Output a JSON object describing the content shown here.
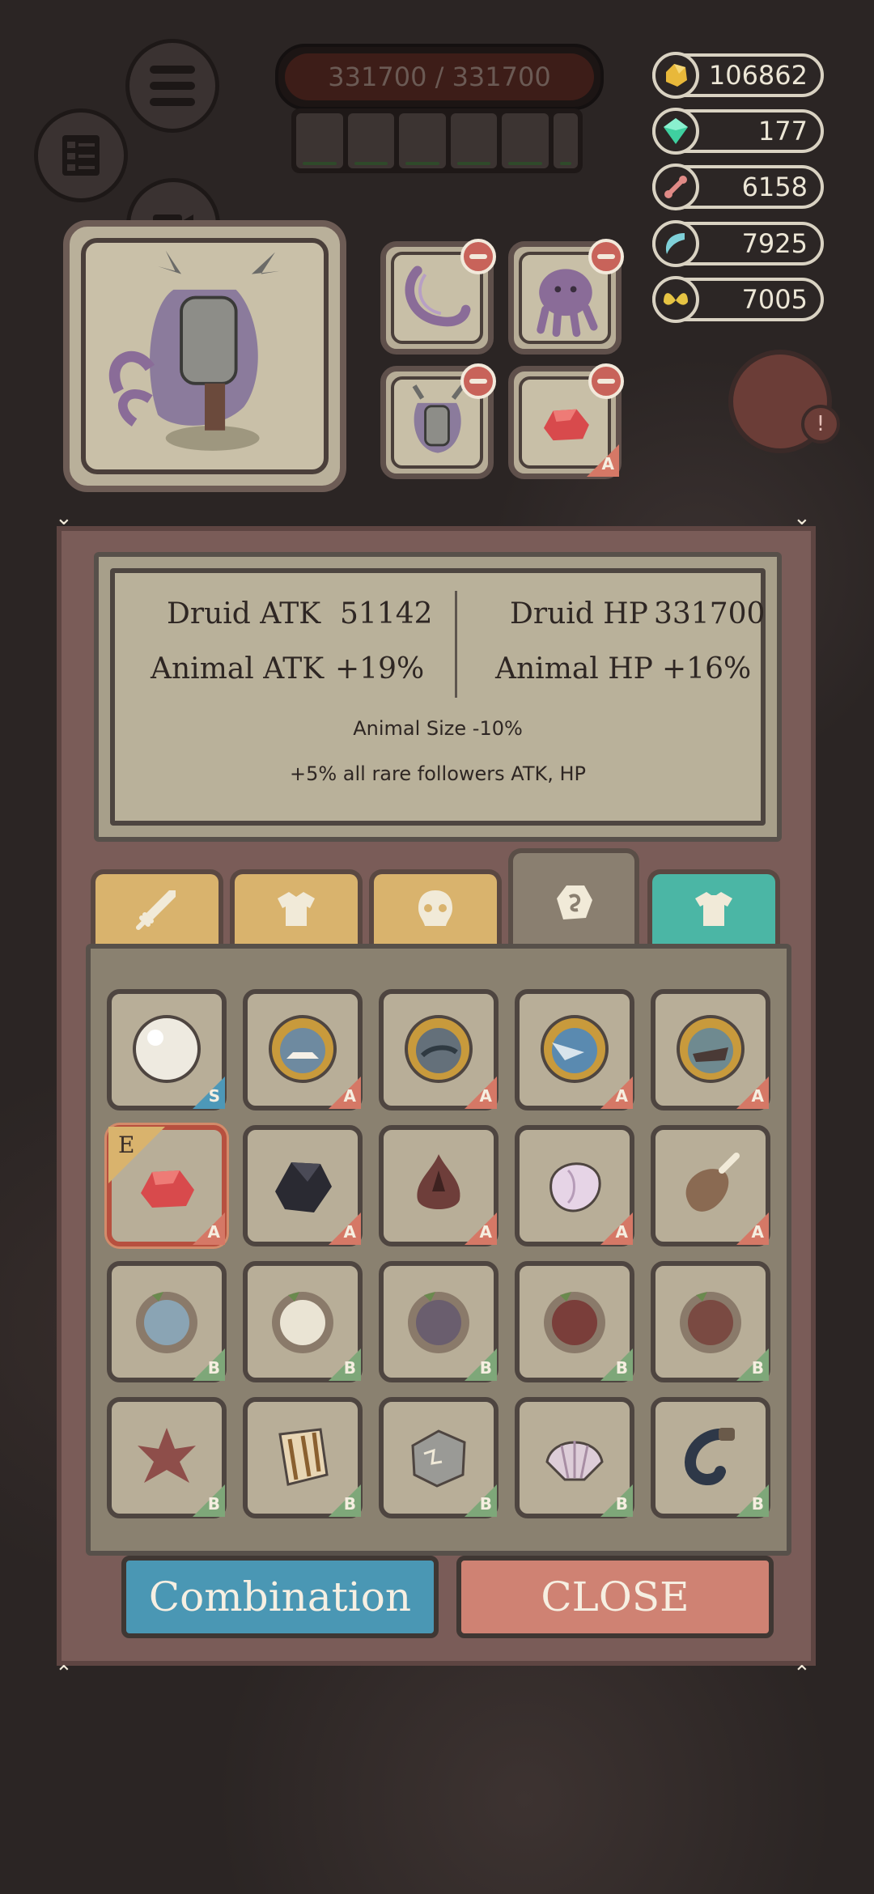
{
  "hud": {
    "hp_text": "331700 / 331700",
    "resources": [
      {
        "name": "gold",
        "value": "106862",
        "color": "#e8b83a",
        "icon": "gold-nugget-icon"
      },
      {
        "name": "gem",
        "value": "177",
        "color": "#3fd0a0",
        "icon": "gem-icon"
      },
      {
        "name": "bone",
        "value": "6158",
        "color": "#e08a86",
        "icon": "bone-icon"
      },
      {
        "name": "fang",
        "value": "7925",
        "color": "#7fd0d8",
        "icon": "fang-icon"
      },
      {
        "name": "wing",
        "value": "7005",
        "color": "#e6c443",
        "icon": "wing-icon"
      }
    ]
  },
  "stats": {
    "druid_atk_label": "Druid ATK",
    "druid_atk_value": "51142",
    "druid_hp_label": "Druid HP",
    "druid_hp_value": "331700",
    "animal_atk_label": "Animal ATK",
    "animal_atk_value": "+19%",
    "animal_hp_label": "Animal HP",
    "animal_hp_value": "+16%",
    "line1": "Animal Size -10%",
    "line2": "+5% all rare followers ATK, HP"
  },
  "equipped": {
    "slot_grade": "A"
  },
  "tabs": [
    {
      "icon": "sword-icon",
      "active": false
    },
    {
      "icon": "armor-icon",
      "active": false
    },
    {
      "icon": "skull-icon",
      "active": false
    },
    {
      "icon": "stone-icon",
      "active": true
    },
    {
      "icon": "shirt-icon",
      "active": false
    }
  ],
  "items": [
    {
      "name": "pearl",
      "grade": "S"
    },
    {
      "name": "shark-amulet",
      "grade": "A"
    },
    {
      "name": "fish-amulet",
      "grade": "A"
    },
    {
      "name": "marlin-amulet",
      "grade": "A"
    },
    {
      "name": "dino-amulet",
      "grade": "A"
    },
    {
      "name": "red-gem",
      "grade": "A",
      "equipped": "E"
    },
    {
      "name": "black-stone",
      "grade": "A"
    },
    {
      "name": "fire-crystal",
      "grade": "A"
    },
    {
      "name": "pink-shell",
      "grade": "A"
    },
    {
      "name": "meat-chunk",
      "grade": "A"
    },
    {
      "name": "blue-wreath",
      "grade": "B"
    },
    {
      "name": "white-wreath",
      "grade": "B"
    },
    {
      "name": "purple-wreath",
      "grade": "B"
    },
    {
      "name": "red-wreath",
      "grade": "B"
    },
    {
      "name": "brown-wreath",
      "grade": "B"
    },
    {
      "name": "red-leaf",
      "grade": "B"
    },
    {
      "name": "bark-scroll",
      "grade": "B"
    },
    {
      "name": "carved-stone",
      "grade": "B"
    },
    {
      "name": "scallop-shell",
      "grade": "B"
    },
    {
      "name": "horn-hook",
      "grade": "B"
    }
  ],
  "buttons": {
    "combination": "Combination",
    "close": "CLOSE"
  }
}
